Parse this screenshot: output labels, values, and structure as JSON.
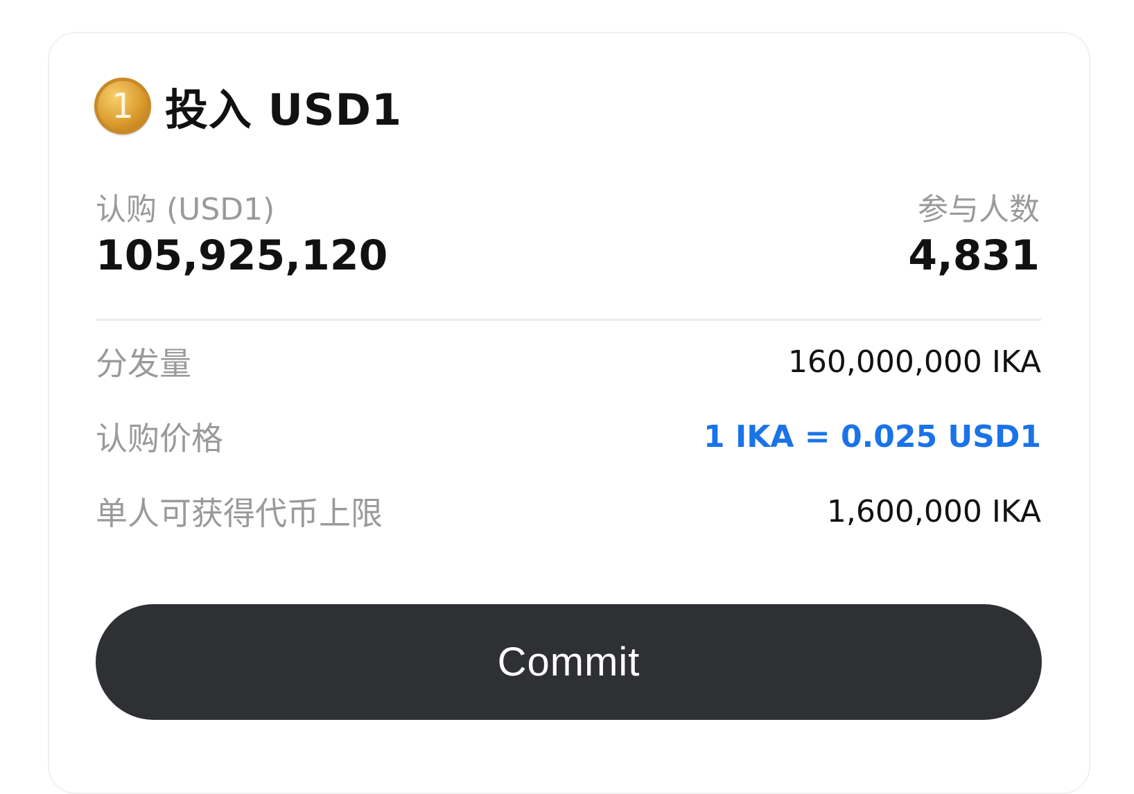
{
  "header": {
    "coin_icon": "usd1-coin-icon",
    "coin_glyph": "1",
    "title": "投入 USD1"
  },
  "stats": {
    "subscribed_label": "认购 (USD1)",
    "subscribed_value": "105,925,120",
    "participants_label": "参与人数",
    "participants_value": "4,831"
  },
  "details": [
    {
      "label": "分发量",
      "value": "160,000,000 IKA"
    },
    {
      "label": "认购价格",
      "value": "1 IKA = 0.025 USD1"
    },
    {
      "label": "单人可获得代币上限",
      "value": "1,600,000 IKA"
    }
  ],
  "actions": {
    "commit_label": "Commit"
  },
  "colors": {
    "accent": "#1a73e8",
    "button": "#2f3033",
    "coin": "#d9982a"
  }
}
